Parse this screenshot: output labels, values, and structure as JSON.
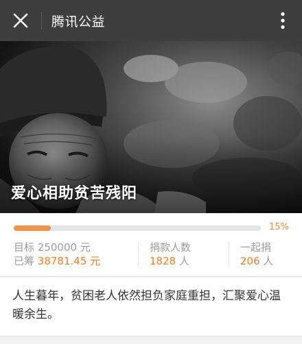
{
  "header": {
    "title": "腾讯公益"
  },
  "hero": {
    "title": "爱心相助贫苦残阳"
  },
  "progress": {
    "percent_value": 0.15,
    "percent_label": "15%"
  },
  "stats": {
    "target_label": "目标",
    "target_value": "250000",
    "target_unit": "元",
    "raised_label": "已筹",
    "raised_value": "38781.45",
    "raised_unit": "元",
    "donors_label": "捐款人数",
    "donors_value": "1828",
    "donors_unit": "人",
    "together_label": "一起捐",
    "together_value": "206",
    "together_unit": "人"
  },
  "description": {
    "text": "人生暮年，贫困老人依然担负家庭重担，汇聚爱心温暖余生。"
  },
  "colors": {
    "topbar": "#3e3e3e",
    "accent": "#f07d28",
    "progress_fill": "#f2944e"
  }
}
